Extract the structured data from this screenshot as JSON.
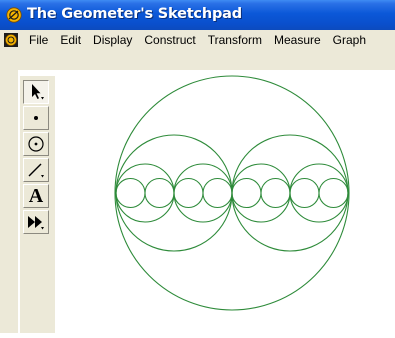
{
  "window": {
    "title": "The Geometer's Sketchpad",
    "app_icon": "sketchpad-app-icon"
  },
  "menubar": {
    "doc_icon": "sketch-document-icon",
    "items": [
      "File",
      "Edit",
      "Display",
      "Construct",
      "Transform",
      "Measure",
      "Graph"
    ]
  },
  "toolbox": {
    "tools": [
      {
        "name": "selection-arrow-tool",
        "active": true
      },
      {
        "name": "point-tool",
        "active": false
      },
      {
        "name": "compass-tool",
        "active": false
      },
      {
        "name": "straightedge-tool",
        "active": false
      },
      {
        "name": "text-tool",
        "label": "A",
        "active": false
      },
      {
        "name": "custom-tool",
        "active": false
      }
    ]
  },
  "sketch": {
    "stroke_color": "#2e8b3a",
    "description_shapes": "outer circle enclosing two circles, each containing inner circles tangent along a horizontal diameter"
  }
}
